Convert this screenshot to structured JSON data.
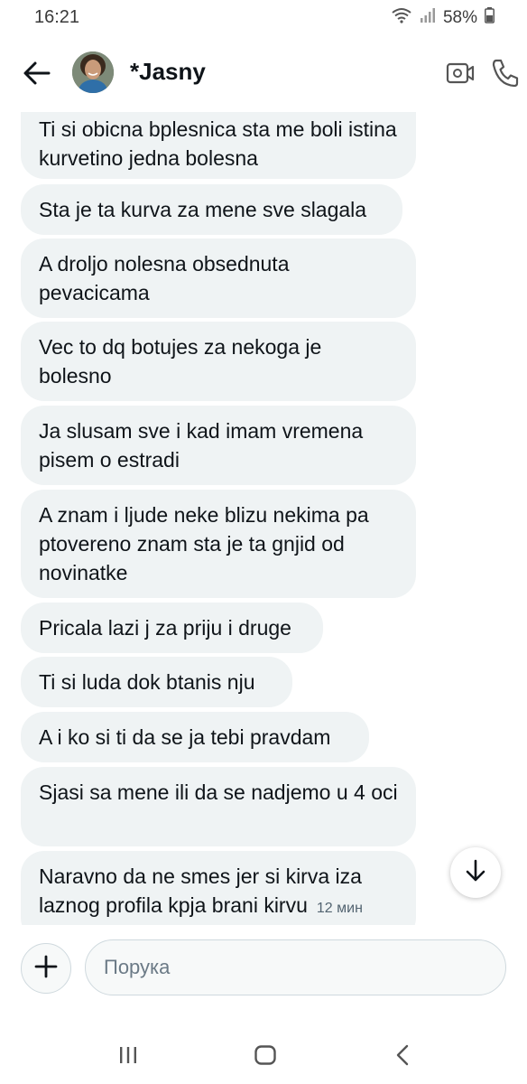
{
  "status_bar": {
    "time": "16:21",
    "battery": "58%"
  },
  "header": {
    "contact_name": "*Jasny"
  },
  "messages": [
    {
      "text": "Ti si obicna bplesnica sta me boli istina kurvetino jedna bolesna"
    },
    {
      "text": "Sta je ta kurva za mene sve slagala"
    },
    {
      "text": "A droljo nolesna obsednuta pevacicama"
    },
    {
      "text": "Vec to dq botujes za nekoga je bolesno"
    },
    {
      "text": "Ja slusam sve i kad imam vremena pisem o estradi"
    },
    {
      "text": "A znam i ljude neke blizu nekima pa ptovereno znam sta je ta gnjid od novinatke"
    },
    {
      "text": "Pricala lazi j za priju i druge"
    },
    {
      "text": "Ti si luda dok btanis nju"
    },
    {
      "text": "A i ko si ti da se ja tebi pravdam"
    },
    {
      "text": "Sjasi sa mene ili da se nadjemo u 4 oci"
    },
    {
      "text": "Naravno da ne smes jer si kirva iza laznog profila kpja brani kirvu",
      "time": "12 мин"
    }
  ],
  "composer": {
    "placeholder": "Порука"
  },
  "icons": {
    "back": "arrow-left-icon",
    "video": "video-camera-icon",
    "call": "phone-icon",
    "scroll_down": "arrow-down-icon",
    "add": "plus-icon"
  },
  "colors": {
    "bubble_bg": "#eff3f4",
    "text": "#0f1419",
    "muted": "#536471"
  }
}
